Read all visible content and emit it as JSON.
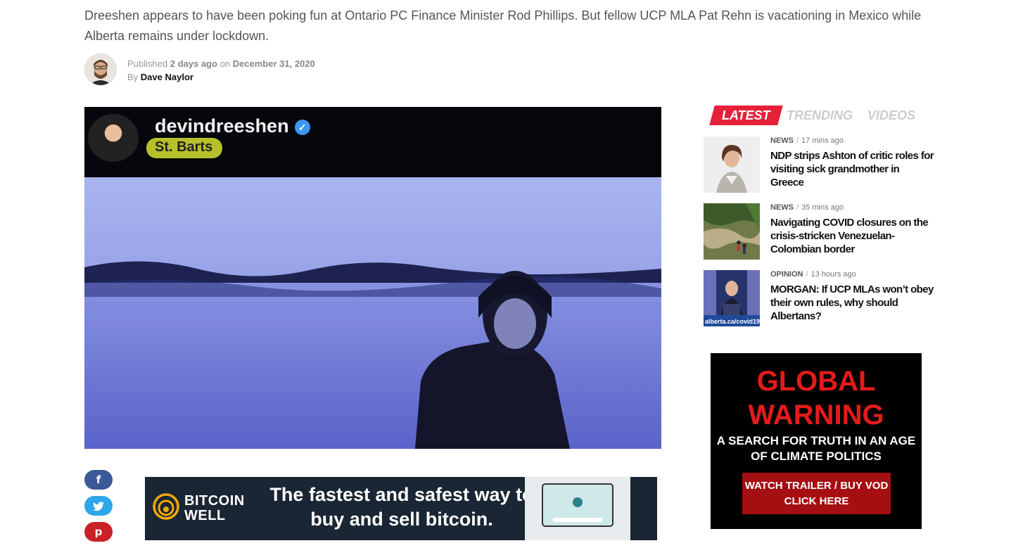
{
  "article": {
    "subtitle": "Dreeshen appears to have been poking fun at Ontario PC Finance Minister Rod Phillips. But fellow UCP MLA Pat Rehn is vacationing in Mexico while Alberta remains under lockdown.",
    "published_label": "Published",
    "published_relative": "2 days ago",
    "on_label": "on",
    "published_date": "December 31, 2020",
    "by_label": "By",
    "author": "Dave Naylor"
  },
  "hero": {
    "handle": "devindreeshen",
    "location": "St. Barts",
    "verified_icon": "verified-check-icon"
  },
  "social": [
    {
      "name": "facebook",
      "glyph": "f",
      "color": "#3b5998"
    },
    {
      "name": "twitter",
      "glyph": "t",
      "color": "#2ea6e8"
    },
    {
      "name": "pinterest",
      "glyph": "p",
      "color": "#cb2027"
    }
  ],
  "ad_bitcoin": {
    "brand_line1": "BITCOIN",
    "brand_line2": "WELL",
    "tagline": "The fastest and safest way to buy and sell bitcoin.",
    "background": "#1b2634"
  },
  "sidebar": {
    "tabs": [
      "LATEST",
      "TRENDING",
      "VIDEOS"
    ],
    "accent": "#e5213a",
    "items": [
      {
        "category": "NEWS",
        "time": "17 mins ago",
        "title": "NDP strips Ashton of critic roles for visiting sick grandmother in Greece"
      },
      {
        "category": "NEWS",
        "time": "35 mins ago",
        "title": "Navigating COVID closures on the crisis-stricken Venezuelan-Colombian border"
      },
      {
        "category": "OPINION",
        "time": "13 hours ago",
        "title": "MORGAN: If UCP MLAs won’t obey their own rules, why should Albertans?",
        "thumb_caption": "alberta.ca/covid19"
      }
    ]
  },
  "ad_global": {
    "title": "GLOBAL WARNING",
    "subtitle": "A SEARCH FOR TRUTH IN AN AGE OF CLIMATE POLITICS",
    "cta": "WATCH TRAILER / BUY VOD CLICK HERE"
  }
}
